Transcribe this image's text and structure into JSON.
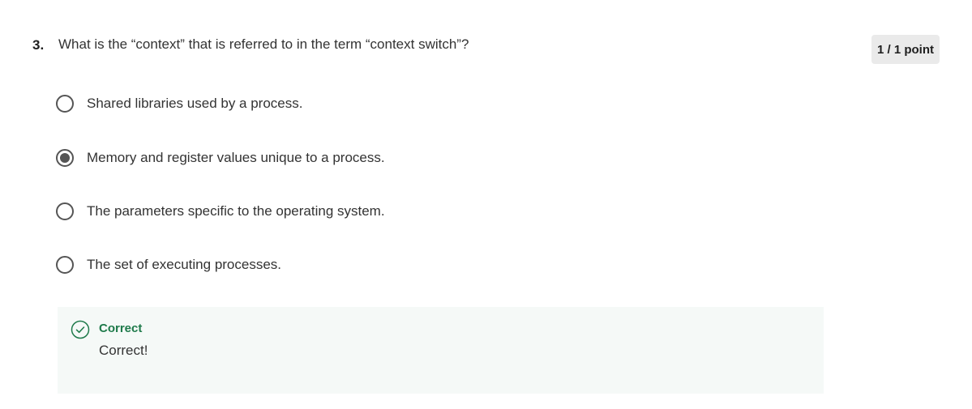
{
  "question": {
    "number": "3.",
    "text": "What is the “context” that is referred to in the term “context switch”?",
    "points": "1 / 1 point"
  },
  "options": [
    {
      "label": "Shared libraries used by a process.",
      "selected": false
    },
    {
      "label": "Memory and register values unique to a process.",
      "selected": true
    },
    {
      "label": "The parameters specific to the operating system.",
      "selected": false
    },
    {
      "label": "The set of executing processes.",
      "selected": false
    }
  ],
  "feedback": {
    "title": "Correct",
    "text": "Correct!",
    "icon": "check-circle-icon",
    "color": "#1e7a4a"
  },
  "colors": {
    "radio": "#555555",
    "badge_bg": "#eaeaea",
    "feedback_bg": "#f5f9f7"
  }
}
